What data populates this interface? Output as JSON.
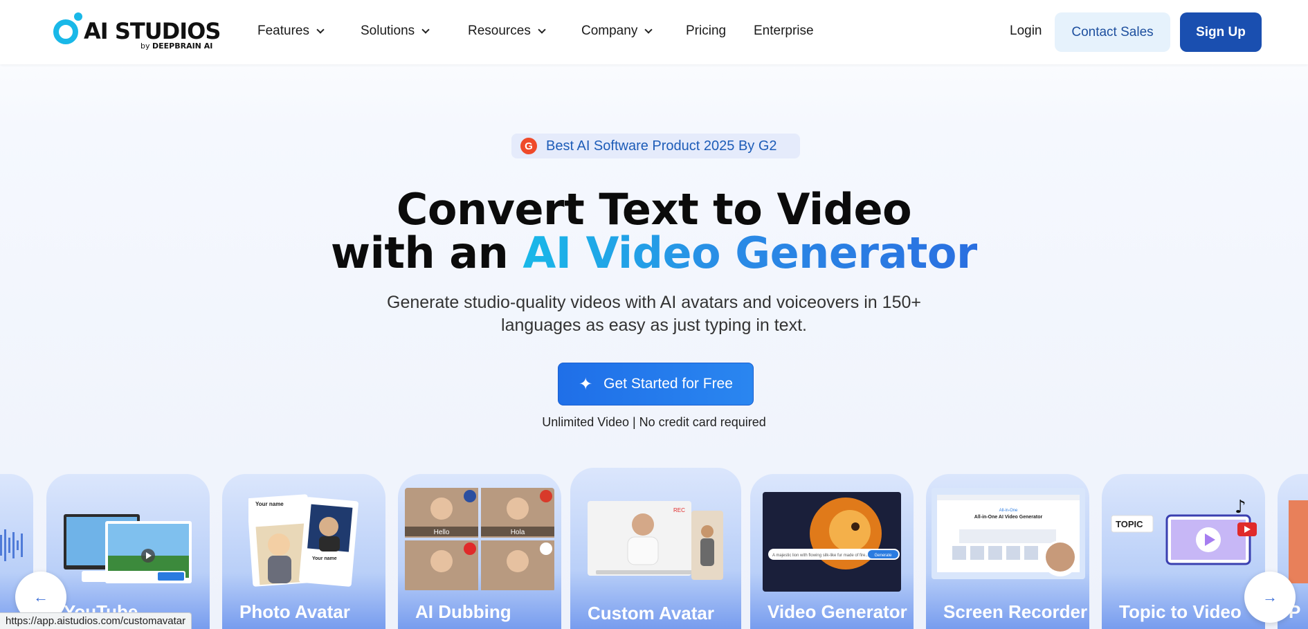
{
  "brand": {
    "logo_text": "AI STUDIOS",
    "logo_by": "by",
    "logo_company": "DEEPBRAIN AI",
    "accent": "#19b8e8",
    "primary": "#1a4fb0"
  },
  "nav": {
    "items": [
      {
        "label": "Features",
        "dropdown": true
      },
      {
        "label": "Solutions",
        "dropdown": true
      },
      {
        "label": "Resources",
        "dropdown": true
      },
      {
        "label": "Company",
        "dropdown": true
      },
      {
        "label": "Pricing",
        "dropdown": false
      },
      {
        "label": "Enterprise",
        "dropdown": false
      }
    ],
    "login": "Login",
    "contact_sales": "Contact Sales",
    "sign_up": "Sign Up"
  },
  "hero": {
    "badge_icon": "G",
    "badge_text": "Best AI Software Product 2025 By G2",
    "title_line1": "Convert Text to Video",
    "title_line2_prefix": "with an ",
    "title_line2_highlight": "AI Video Generator",
    "subtitle_line1": "Generate studio-quality videos with AI avatars and voiceovers in 150+",
    "subtitle_line2": "languages as easy as just typing in text.",
    "cta_label": "Get Started for Free",
    "note": "Unlimited Video | No credit card required"
  },
  "cards": [
    {
      "label": ""
    },
    {
      "label": "YouTube"
    },
    {
      "label": "Photo Avatar",
      "thumb_name1": "Your name",
      "thumb_name2": "Your name"
    },
    {
      "label": "AI Dubbing",
      "captions": [
        "Hello",
        "Hola"
      ]
    },
    {
      "label": "Custom Avatar",
      "rec": "REC"
    },
    {
      "label": "Video Generator",
      "prompt": "A majestic lion with flowing silk-like fur made of fire...",
      "generate": "Generate"
    },
    {
      "label": "Screen Recorder",
      "screen_title": "All-in-One AI Video Generator"
    },
    {
      "label": "Topic to Video",
      "topic_tag": "TOPIC"
    },
    {
      "label": "P"
    }
  ],
  "status_url": "https://app.aistudios.com/customavatar"
}
